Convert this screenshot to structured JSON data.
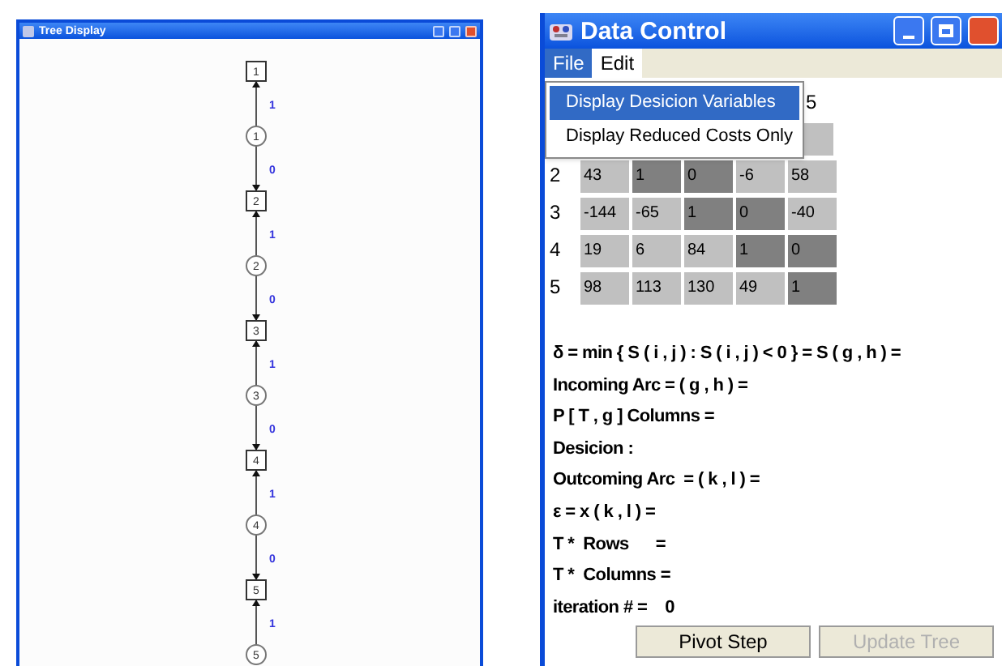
{
  "tree_window": {
    "title": "Tree Display",
    "nodes": [
      {
        "kind": "square",
        "label": "1"
      },
      {
        "kind": "circle",
        "label": "1"
      },
      {
        "kind": "square",
        "label": "2"
      },
      {
        "kind": "circle",
        "label": "2"
      },
      {
        "kind": "square",
        "label": "3"
      },
      {
        "kind": "circle",
        "label": "3"
      },
      {
        "kind": "square",
        "label": "4"
      },
      {
        "kind": "circle",
        "label": "4"
      },
      {
        "kind": "square",
        "label": "5"
      },
      {
        "kind": "circle",
        "label": "5"
      }
    ],
    "edges": [
      {
        "label": "1",
        "kind": "up"
      },
      {
        "label": "0",
        "kind": "down"
      },
      {
        "label": "1",
        "kind": "up"
      },
      {
        "label": "0",
        "kind": "down"
      },
      {
        "label": "1",
        "kind": "up"
      },
      {
        "label": "0",
        "kind": "down"
      },
      {
        "label": "1",
        "kind": "up"
      },
      {
        "label": "0",
        "kind": "down"
      },
      {
        "label": "1",
        "kind": "up"
      }
    ]
  },
  "data_window": {
    "title": "Data Control",
    "menus": [
      {
        "label": "File",
        "selected": true
      },
      {
        "label": "Edit",
        "selected": false
      }
    ],
    "file_menu": [
      {
        "label": "Display Desicion Variables",
        "selected": true
      },
      {
        "label": "Display Reduced Costs Only",
        "selected": false
      }
    ],
    "table": {
      "column_header": "5",
      "rows": [
        {
          "label": "2",
          "cells": [
            {
              "text": "43",
              "highlighted": false
            },
            {
              "text": "1",
              "highlighted": true
            },
            {
              "text": "0",
              "highlighted": true
            },
            {
              "text": "-6",
              "highlighted": false
            },
            {
              "text": "58",
              "highlighted": false
            }
          ]
        },
        {
          "label": "3",
          "cells": [
            {
              "text": "-144",
              "highlighted": false
            },
            {
              "text": "-65",
              "highlighted": false
            },
            {
              "text": "1",
              "highlighted": true
            },
            {
              "text": "0",
              "highlighted": true
            },
            {
              "text": "-40",
              "highlighted": false
            }
          ]
        },
        {
          "label": "4",
          "cells": [
            {
              "text": "19",
              "highlighted": false
            },
            {
              "text": "6",
              "highlighted": false
            },
            {
              "text": "84",
              "highlighted": false
            },
            {
              "text": "1",
              "highlighted": true
            },
            {
              "text": "0",
              "highlighted": true
            }
          ]
        },
        {
          "label": "5",
          "cells": [
            {
              "text": "98",
              "highlighted": false
            },
            {
              "text": "113",
              "highlighted": false
            },
            {
              "text": "130",
              "highlighted": false
            },
            {
              "text": "49",
              "highlighted": false
            },
            {
              "text": "1",
              "highlighted": true
            }
          ]
        }
      ]
    },
    "lines": [
      "δ = min { S ( i , j ) : S ( i , j ) < 0 } = S ( g , h ) =",
      "Incoming Arc = ( g , h ) =",
      "P [ T , g ] Columns =",
      "Desicion :",
      "Outcoming Arc  = ( k , l ) =",
      "ε = x ( k , l ) =",
      "T *  Rows      =",
      "T *  Columns =",
      "iteration # =    0"
    ],
    "buttons": [
      {
        "label": "Pivot Step",
        "disabled": false
      },
      {
        "label": "Update Tree",
        "disabled": true
      }
    ]
  }
}
